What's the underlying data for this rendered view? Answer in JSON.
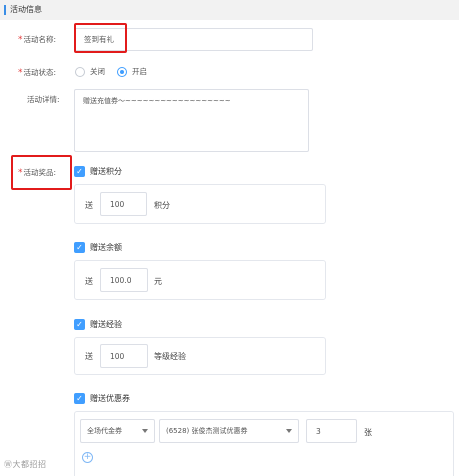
{
  "section": {
    "title": "活动信息"
  },
  "name_field": {
    "label": "活动名称:",
    "value": "签到有礼",
    "required_mark": "*"
  },
  "status_field": {
    "label": "活动状态:",
    "required_mark": "*",
    "options": [
      {
        "label": "关闭",
        "selected": false
      },
      {
        "label": "开启",
        "selected": true
      }
    ]
  },
  "detail_field": {
    "label": "活动详情:",
    "value": "赠送充值券～~~~~~~~~~~~~~~~~~~"
  },
  "prize_field": {
    "label": "活动奖品:",
    "required_mark": "*"
  },
  "prizes": {
    "points": {
      "checkbox_label": "赠送积分",
      "prefix": "送",
      "value": "100",
      "unit": "积分"
    },
    "balance": {
      "checkbox_label": "赠送余额",
      "prefix": "送",
      "value": "100.0",
      "unit": "元"
    },
    "experience": {
      "checkbox_label": "赠送经验",
      "prefix": "送",
      "value": "100",
      "unit": "等级经验"
    },
    "coupon": {
      "checkbox_label": "赠送优惠券",
      "type_select": "全场代金券",
      "coupon_select": "(6528) 张俊杰测试优惠券",
      "qty": "3",
      "unit": "张"
    }
  },
  "watermark": "Ⓦ大都招招",
  "colors": {
    "accent": "#409eff",
    "required": "#e23c3c",
    "highlight_box": "#e21b1b"
  }
}
